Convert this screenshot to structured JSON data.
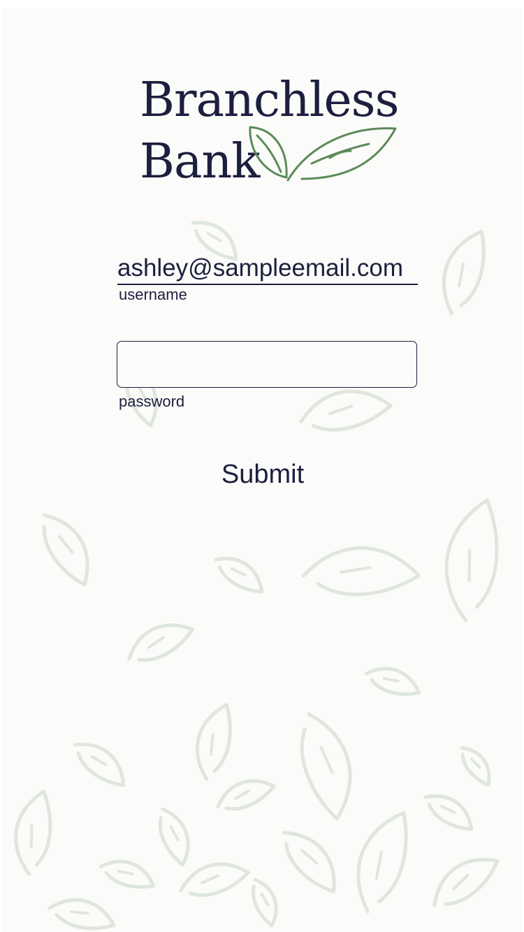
{
  "brand": {
    "name_line_1": "Branchless",
    "name_line_2": "Bank",
    "logo_icon": "leaf-pair-icon",
    "logo_leaf_color": "#5b8a5a"
  },
  "login": {
    "username_value": "ashley@sampleemail.com",
    "username_label": "username",
    "password_value": "",
    "password_label": "password",
    "submit_label": "Submit"
  },
  "theme": {
    "background": "#fbfbf9",
    "text_color": "#1d1f3f",
    "background_leaf_color": "#dfe6de",
    "background_pattern": "scattered-leaves"
  }
}
